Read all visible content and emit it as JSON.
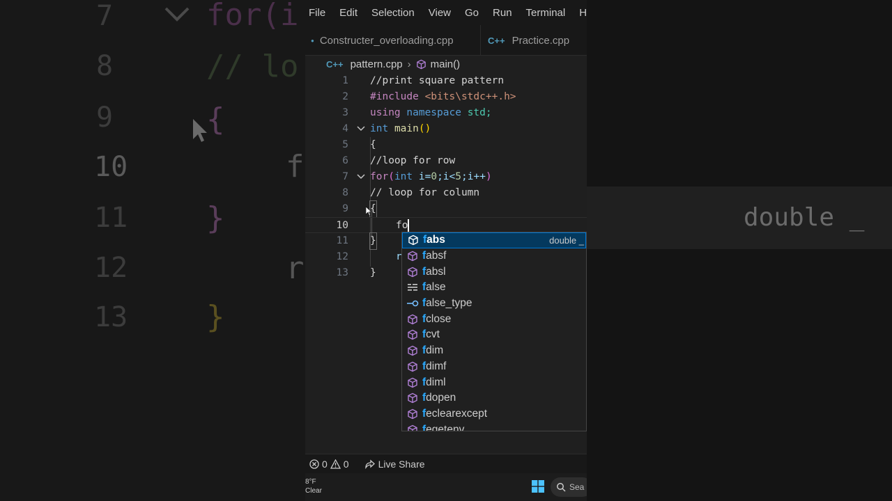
{
  "menu": [
    "File",
    "Edit",
    "Selection",
    "View",
    "Go",
    "Run",
    "Terminal",
    "He"
  ],
  "tabs": [
    {
      "label": "Constructer_overloading.cpp",
      "icon": "dot-icon"
    },
    {
      "label": "Practice.cpp",
      "icon": "cpp-file-icon",
      "icon_text": "C++"
    }
  ],
  "breadcrumb": {
    "icon_text": "C++",
    "file": "pattern.cpp",
    "symbol": "main()"
  },
  "line_numbers": [
    "1",
    "2",
    "3",
    "4",
    "5",
    "6",
    "7",
    "8",
    "9",
    "10",
    "11",
    "12",
    "13"
  ],
  "code_text": {
    "l1": "//print square pattern",
    "l2_pp": "#include",
    "l2_hdr": "<bits\\stdc++.h>",
    "l3_kw1": "using",
    "l3_kw2": "namespace",
    "l3_rest": "std;",
    "l4_type": "int",
    "l4_fn": "main",
    "l4_paren": "()",
    "l5": "{",
    "l6": "//loop for row",
    "l7_for": "for",
    "l7_open": "(",
    "l7_int": "int",
    "l7_var": "i=",
    "l7_n0": "0",
    "l7_mid": ";i<",
    "l7_n5": "5",
    "l7_end": ";i++",
    "l7_close": ")",
    "l8": "// loop for column",
    "l9": "{",
    "l10": "fo",
    "l11": "}",
    "l12": "r",
    "l13": "}"
  },
  "suggestions": [
    {
      "match": "f",
      "rest": "abs",
      "icon": "method-cube-icon",
      "detail": "double _"
    },
    {
      "match": "f",
      "rest": "absf",
      "icon": "method-cube-icon"
    },
    {
      "match": "f",
      "rest": "absl",
      "icon": "method-cube-icon"
    },
    {
      "match": "f",
      "rest": "alse",
      "icon": "keyword-icon"
    },
    {
      "match": "f",
      "rest": "alse_type",
      "icon": "type-param-icon"
    },
    {
      "match": "f",
      "rest": "close",
      "icon": "method-cube-icon"
    },
    {
      "match": "f",
      "rest": "cvt",
      "icon": "method-cube-icon"
    },
    {
      "match": "f",
      "rest": "dim",
      "icon": "method-cube-icon"
    },
    {
      "match": "f",
      "rest": "dimf",
      "icon": "method-cube-icon"
    },
    {
      "match": "f",
      "rest": "diml",
      "icon": "method-cube-icon"
    },
    {
      "match": "f",
      "rest": "dopen",
      "icon": "method-cube-icon"
    },
    {
      "match": "f",
      "rest": "eclearexcept",
      "icon": "method-cube-icon"
    },
    {
      "match": "f",
      "rest": "egetenv",
      "icon": "method-cube-icon"
    }
  ],
  "status": {
    "errors": "0",
    "warnings": "0",
    "live_share": "Live Share"
  },
  "taskbar": {
    "temp": "8°F",
    "weather": "Clear",
    "search": "Sea"
  },
  "background": {
    "left_numbers": [
      "7",
      "8",
      "9",
      "10",
      "11",
      "12",
      "13"
    ],
    "left_code": [
      "for(i",
      "// lo",
      "{",
      "f",
      "}",
      "r",
      "}"
    ],
    "right_text": "double _"
  },
  "colors": {
    "accent": "#0078d4",
    "keyword": "#569cd6",
    "comment": "#6a9955",
    "bracket1": "#ffd700",
    "bracket2": "#da70d6",
    "method_icon": "#b180d7"
  }
}
